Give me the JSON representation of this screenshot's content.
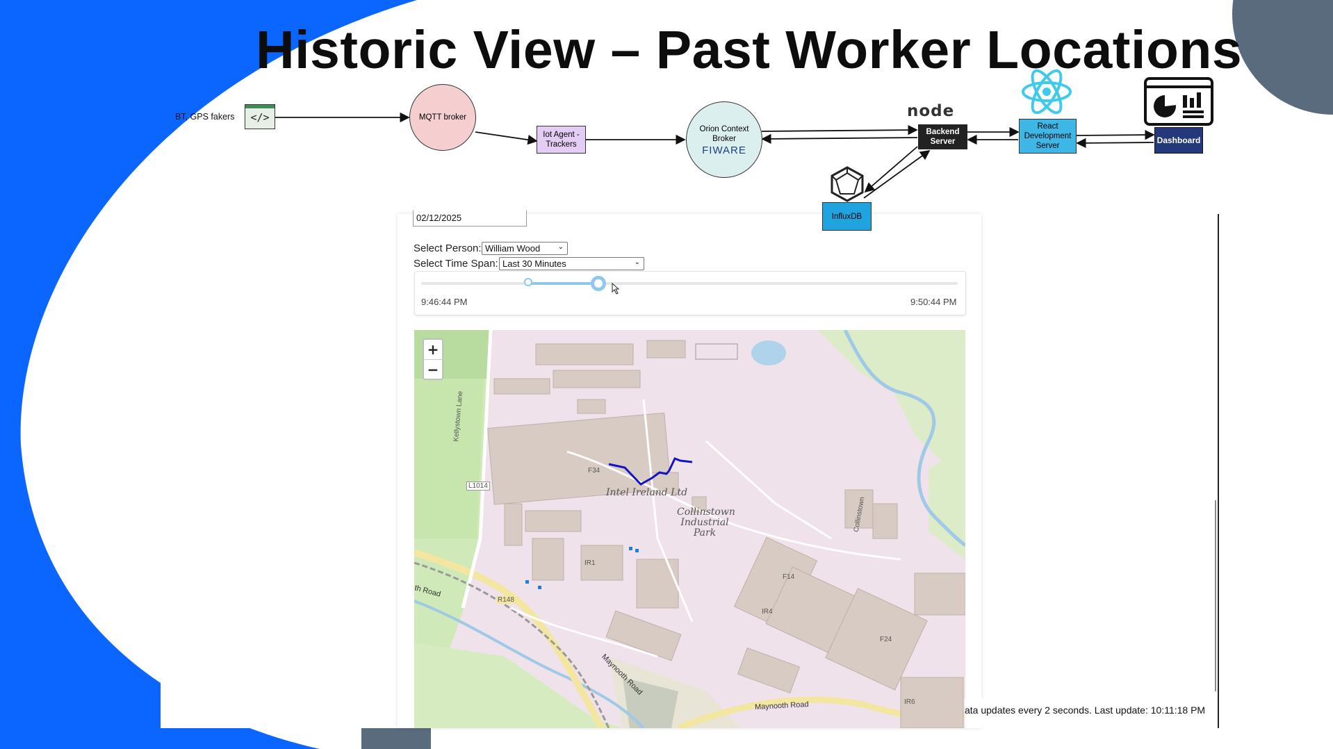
{
  "slide": {
    "title": "Historic View – Past Worker Locations",
    "colors": {
      "accent_blue": "#0a66ff",
      "corner_gray": "#5b6b7e"
    }
  },
  "diagram": {
    "source_label": "BT, GPS fakers",
    "mqtt": "MQTT broker",
    "iot_agent": "Iot Agent - Trackers",
    "orion_line1": "Orion Context",
    "orion_line2": "Broker",
    "fiware": "FIWARE",
    "node_logo": "node",
    "backend": "Backend Server",
    "react": "React Development Server",
    "dashboard": "Dashboard",
    "influx": "InfluxDB"
  },
  "app": {
    "date_value": "02/12/2025",
    "person_label": "Select Person:",
    "person_value": "William Wood",
    "timespan_label": "Select Time Span:",
    "timespan_value": "Last 30 Minutes",
    "slider_start": "9:46:44 PM",
    "slider_end": "9:50:44 PM",
    "slider_range": {
      "low_fraction": 0.2,
      "high_fraction": 0.33
    },
    "zoom_in": "+",
    "zoom_out": "−",
    "status": "ata updates every 2 seconds. Last update: 10:11:18 PM"
  },
  "map": {
    "labels": {
      "place": "Intel Ireland Ltd",
      "park": "Collinstown Industrial Park",
      "f34": "F34",
      "ir1": "IR1",
      "f14": "F14",
      "ir4": "IR4",
      "f24": "F24",
      "ir6": "IR6",
      "l1014": "L1014",
      "r148": "R148",
      "kellystown": "Kellystown Lane",
      "maynooth_rd": "Maynooth Road",
      "maynooth_rd2": "Maynooth Road",
      "collinstown": "Collinstown",
      "road_cut": "th Road"
    },
    "track_color": "#1313c8"
  }
}
